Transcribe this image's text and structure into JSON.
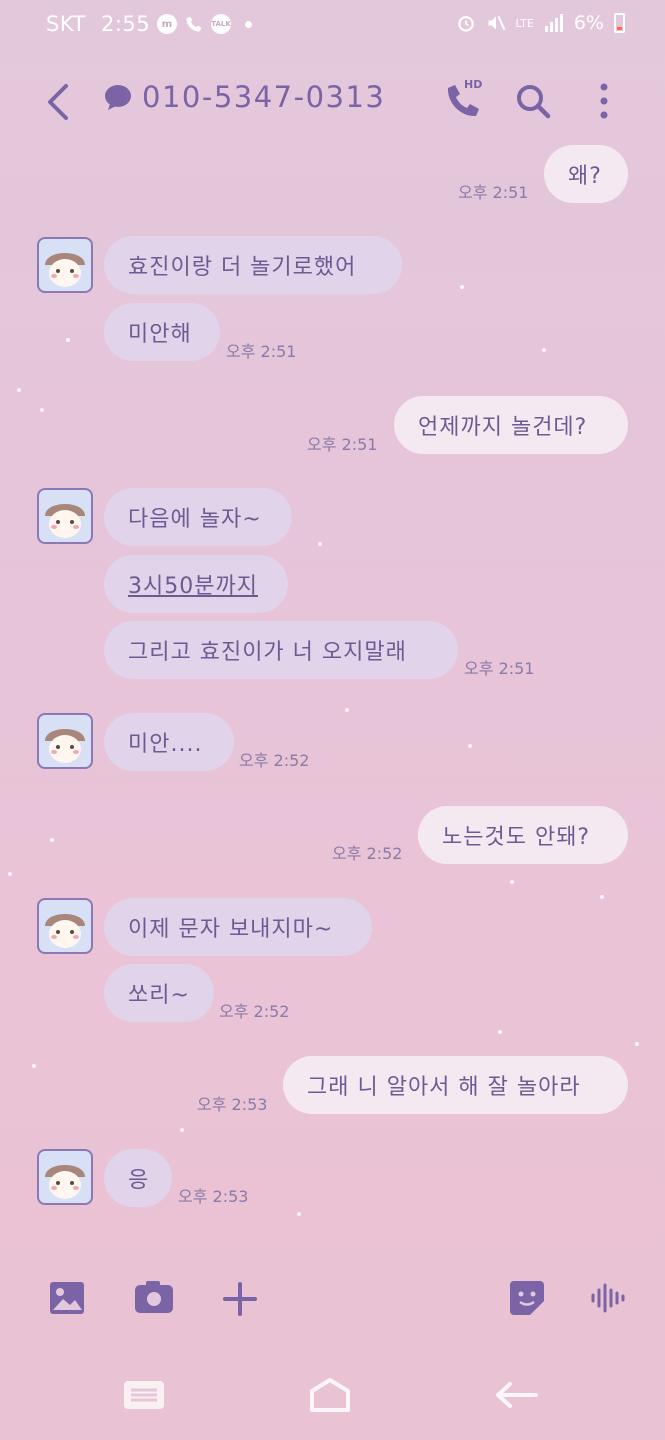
{
  "status_bar": {
    "carrier": "SKT",
    "time": "2:55",
    "notification_icons": [
      "messenger-icon",
      "phone-icon",
      "talk-icon"
    ],
    "battery_percent": "6%",
    "network": "LTE"
  },
  "header": {
    "contact": "010-5347-0313",
    "call_badge": "HD"
  },
  "messages": [
    {
      "side": "out",
      "text": "왜?",
      "time": "오후 2:51"
    },
    {
      "side": "in",
      "text": "효진이랑 더 놀기로했어",
      "time": ""
    },
    {
      "side": "in",
      "text": "미안해",
      "time": "오후 2:51"
    },
    {
      "side": "out",
      "text": "언제까지 놀건데?",
      "time": "오후 2:51"
    },
    {
      "side": "in",
      "text": "다음에 놀자~",
      "time": ""
    },
    {
      "side": "in",
      "text": "3시50분까지",
      "time": ""
    },
    {
      "side": "in",
      "text": "그리고 효진이가 너 오지말래",
      "time": "오후 2:51"
    },
    {
      "side": "in",
      "text": "미안....",
      "time": "오후 2:52"
    },
    {
      "side": "out",
      "text": "노는것도 안돼?",
      "time": "오후 2:52"
    },
    {
      "side": "in",
      "text": "이제 문자 보내지마~",
      "time": ""
    },
    {
      "side": "in",
      "text": "쏘리~",
      "time": "오후 2:52"
    },
    {
      "side": "out",
      "text": "그래 니 알아서 해 잘 놀아라",
      "time": "오후 2:53"
    },
    {
      "side": "in",
      "text": "응",
      "time": "오후 2:53"
    }
  ],
  "input_bar": {
    "icons": [
      "gallery-icon",
      "camera-icon",
      "plus-icon",
      "sticker-icon",
      "voice-icon"
    ]
  },
  "nav_bar": {
    "icons": [
      "recent-apps-icon",
      "home-icon",
      "back-nav-icon"
    ]
  }
}
